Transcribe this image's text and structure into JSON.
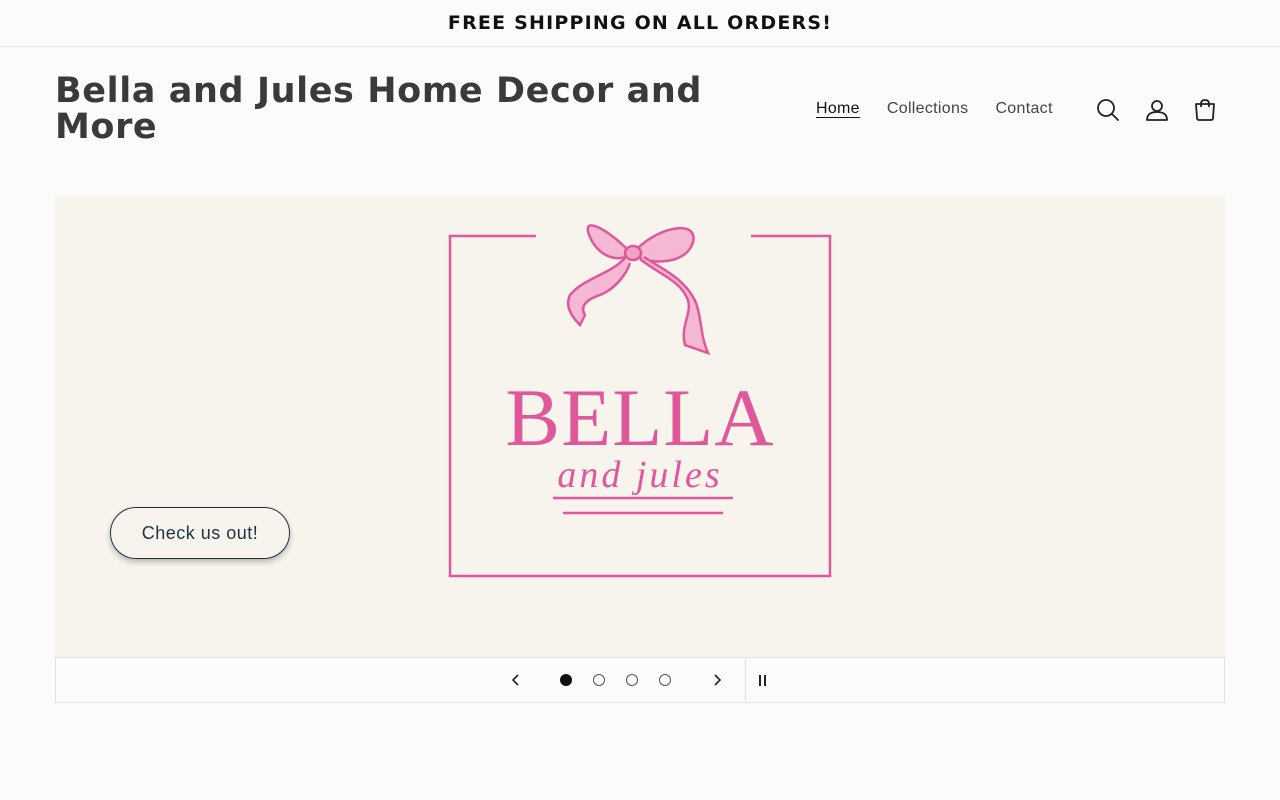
{
  "announcement": {
    "text": "FREE SHIPPING ON ALL ORDERS!"
  },
  "header": {
    "site_title": "Bella and Jules Home Decor and More",
    "nav": [
      {
        "label": "Home",
        "active": true
      },
      {
        "label": "Collections",
        "active": false
      },
      {
        "label": "Contact",
        "active": false
      }
    ],
    "icons": [
      "search-icon",
      "account-icon",
      "cart-icon"
    ]
  },
  "slideshow": {
    "logo": {
      "main": "BELLA",
      "sub": "and jules"
    },
    "cta_label": "Check us out!",
    "slide_count": 4,
    "current_slide": 1,
    "colors": {
      "logo_pink": "#e0579a",
      "slide_bg": "#f7f4ee",
      "cta_border": "#1c3440"
    }
  }
}
